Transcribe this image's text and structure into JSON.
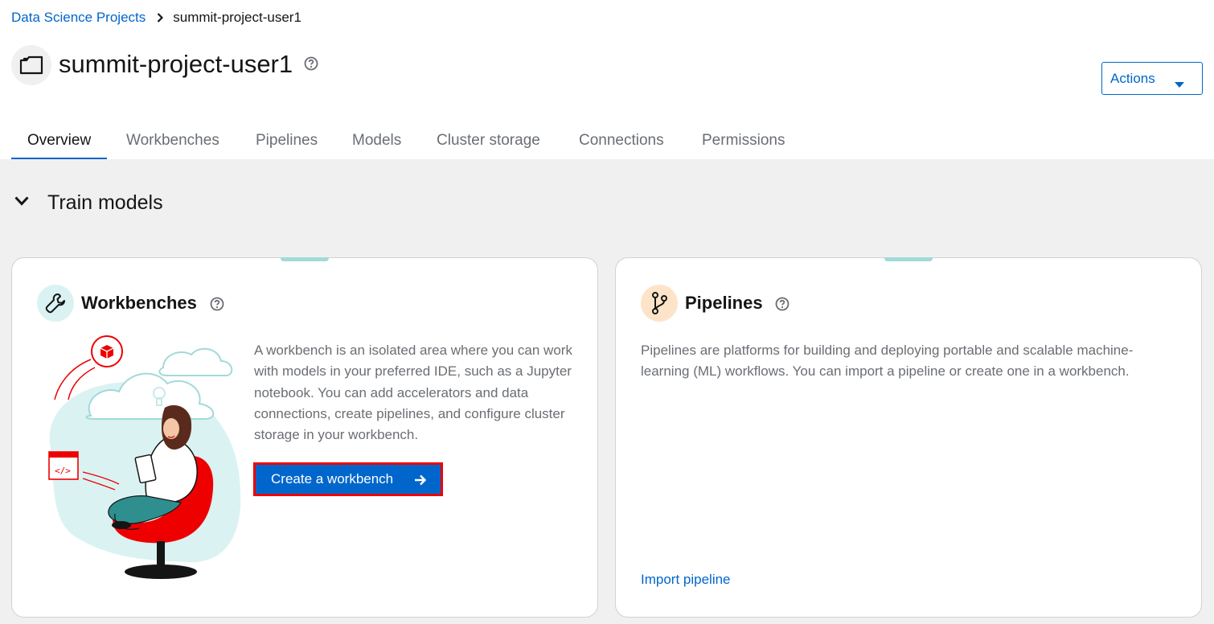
{
  "breadcrumb": {
    "parent": "Data Science Projects",
    "current": "summit-project-user1"
  },
  "project": {
    "title": "summit-project-user1"
  },
  "header": {
    "actions_label": "Actions"
  },
  "tabs": [
    {
      "label": "Overview",
      "active": true
    },
    {
      "label": "Workbenches"
    },
    {
      "label": "Pipelines"
    },
    {
      "label": "Models"
    },
    {
      "label": "Cluster storage"
    },
    {
      "label": "Connections"
    },
    {
      "label": "Permissions"
    }
  ],
  "section": {
    "title": "Train models"
  },
  "cards": {
    "workbenches": {
      "title": "Workbenches",
      "description": "A workbench is an isolated area where you can work with models in your preferred IDE, such as a Jupyter notebook. You can add accelerators and data connections, create pipelines, and configure cluster storage in your workbench.",
      "button_label": "Create a workbench"
    },
    "pipelines": {
      "title": "Pipelines",
      "description": "Pipelines are platforms for building and deploying portable and scalable machine-learning (ML) workflows. You can import a pipeline or create one in a workbench.",
      "link_label": "Import pipeline"
    }
  },
  "colors": {
    "link": "#0066cc",
    "highlight_border": "#ee0000",
    "accent_teal": "#a2d9d9",
    "pipelines_icon_bg": "#fde4c8"
  }
}
